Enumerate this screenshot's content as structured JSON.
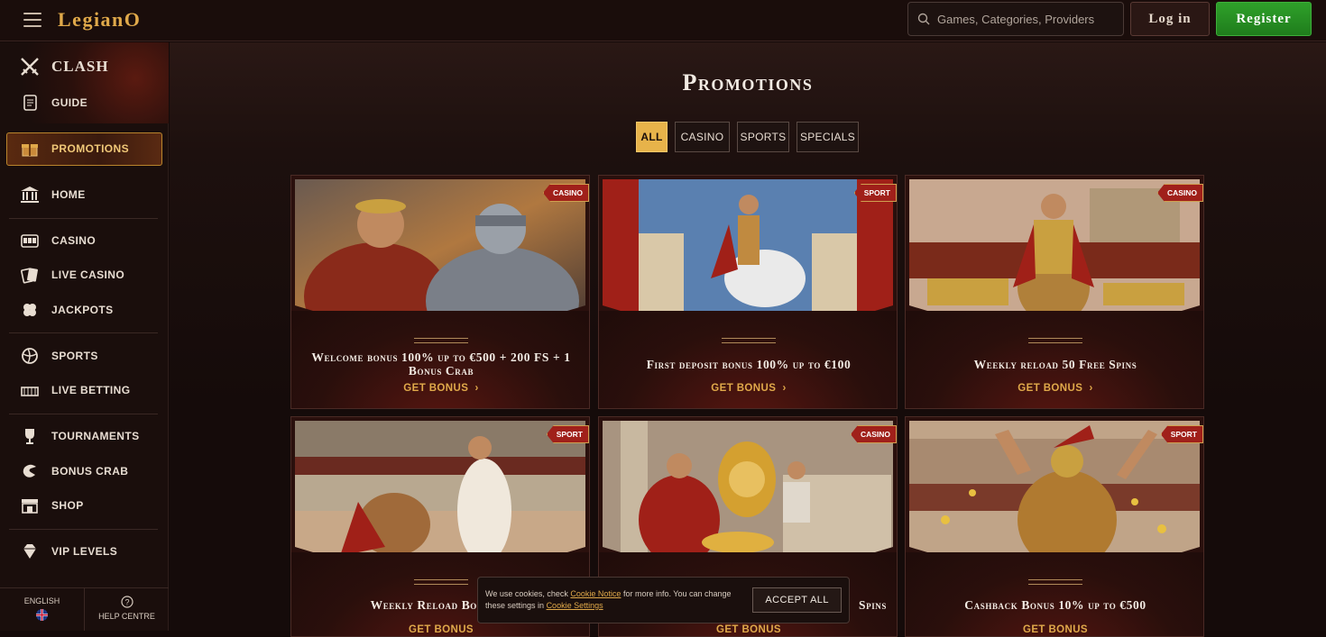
{
  "header": {
    "logo": "LegianO",
    "search_placeholder": "Games, Categories, Providers",
    "login_label": "Log in",
    "register_label": "Register"
  },
  "sidebar": {
    "clash_label": "CLASH",
    "guide_label": "GUIDE",
    "promotions_label": "PROMOTIONS",
    "home_label": "HOME",
    "casino_label": "CASINO",
    "live_casino_label": "LIVE CASINO",
    "jackpots_label": "JACKPOTS",
    "sports_label": "SPORTS",
    "live_betting_label": "LIVE BETTING",
    "tournaments_label": "TOURNAMENTS",
    "bonus_crab_label": "BONUS CRAB",
    "shop_label": "SHOP",
    "vip_label": "VIP LEVELS",
    "language_label": "ENGLISH",
    "help_label": "HELP CENTRE"
  },
  "main": {
    "title": "Promotions",
    "filters": [
      "ALL",
      "CASINO",
      "SPORTS",
      "SPECIALS"
    ],
    "active_filter": "ALL",
    "cta_label": "GET BONUS",
    "cards": [
      {
        "tag": "CASINO",
        "title": "Welcome bonus 100% up to €500 + 200 FS + 1 Bonus Crab"
      },
      {
        "tag": "SPORT",
        "title": "First deposit bonus 100% up to €100"
      },
      {
        "tag": "CASINO",
        "title": "Weekly reload 50 Free Spins"
      },
      {
        "tag": "SPORT",
        "title": "Weekly Reload Bonus 50"
      },
      {
        "tag": "CASINO",
        "title": "Spins"
      },
      {
        "tag": "SPORT",
        "title": "Cashback Bonus 10% up to €500"
      }
    ]
  },
  "cookie": {
    "text_before": "We use cookies, check",
    "notice_link": "Cookie Notice",
    "text_middle": "for more info. You can change these settings in",
    "settings_link": "Cookie Settings",
    "accept_label": "ACCEPT ALL"
  },
  "colors": {
    "accent": "#e0a94a",
    "register": "#2fa02a",
    "tag": "#a0201a"
  }
}
